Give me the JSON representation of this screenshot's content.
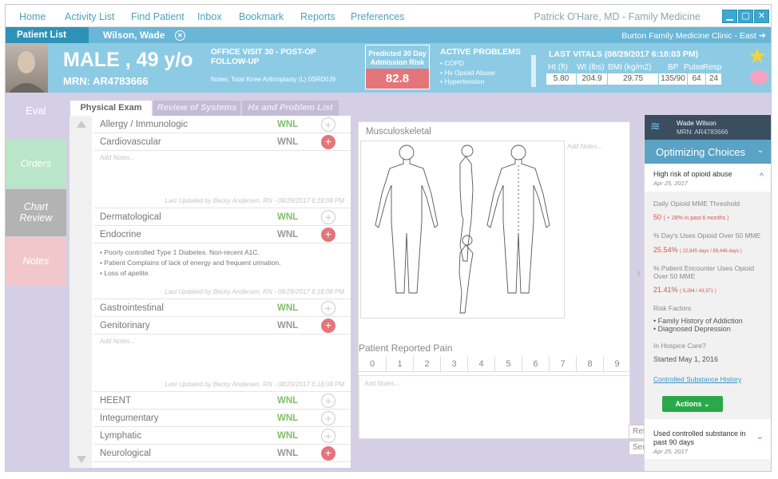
{
  "nav": {
    "items": [
      "Home",
      "Activity List",
      "Find Patient",
      "Inbox",
      "Bookmark",
      "Reports",
      "Preferences"
    ],
    "user": "Patrick O'Hare, MD - Family Medicine"
  },
  "patient_bar": {
    "list_tab": "Patient List",
    "name": "Wilson, Wade",
    "clinic": "Burton Family Medicine Clinic - East"
  },
  "patient": {
    "sex_age": "MALE , 49 y/o",
    "mrn": "MRN: AR4783666"
  },
  "visit": {
    "title_line1": "OFFICE VISIT 30 - POST-OP",
    "title_line2": "FOLLOW-UP",
    "notes": "Notes: Total Knee Arthroplasty (L) 0SRD0J9"
  },
  "risk": {
    "label_line1": "Predicted 30 Day",
    "label_line2": "Admission Risk",
    "value": "82.8"
  },
  "problems": {
    "title": "ACTIVE PROBLEMS",
    "items": [
      "• COPD",
      "• Hx Opioid Abuse",
      "• Hypertension"
    ]
  },
  "vitals": {
    "title": "LAST VITALS",
    "date": "(08/29/2017 6:18:03 PM)",
    "headers": [
      "Ht (ft)",
      "Wt (lbs)",
      "BMI (kg/m2)",
      "BP",
      "Pulse",
      "Resp"
    ],
    "values": [
      "5.80",
      "204.9",
      "29.75",
      "135/90",
      "64",
      "24"
    ]
  },
  "leftnav": {
    "eval": "Eval",
    "orders": "Orders",
    "chart1": "Chart",
    "chart2": "Review",
    "notes": "Notes"
  },
  "tabs": [
    "Physical Exam",
    "Review of Systems",
    "Hx and Problem List"
  ],
  "exam": {
    "wnl": "WNL",
    "add_notes": "Add Notes...",
    "last_updated": "Last Updated by Becky Andersen, RN - 08/29/2017 6:18:08 PM",
    "rows": [
      "Allergy / Immunologic",
      "Cardiovascular",
      "Dermatological",
      "Endocrine",
      "Gastrointestinal",
      "Genitorinary",
      "HEENT",
      "Integumentary",
      "Lymphatic",
      "Neurological"
    ],
    "endocrine_notes": [
      "• Poorly controlled Type 1 Diabetes. Non-recent A1C.",
      "• Patient Complains of lack of energy and frequent urination.",
      "• Loss of apetite."
    ]
  },
  "msk": {
    "title": "Musculoskeletal",
    "add_notes": "Add Notes..."
  },
  "pain": {
    "title": "Patient Reported Pain",
    "scale": [
      "0",
      "1",
      "2",
      "3",
      "4",
      "5",
      "6",
      "7",
      "8",
      "9"
    ],
    "add_notes": "Add Notes...",
    "btn1": "Ref",
    "btn2": "Ser"
  },
  "sidebar": {
    "patient_name": "Wade Wilson",
    "patient_mrn": "MRN: AR4783666",
    "title": "Optimizing Choices",
    "alert1_title": "High risk of opioid abuse",
    "alert1_date": "Apr 25, 2017",
    "mme_label": "Daily Opioid MME Threshold",
    "mme_value": "50",
    "mme_note": "( + 28% in past 6 months )",
    "days_label_1": "% Day's Uses Opioid Over 50 MME",
    "days_value": "25.54%",
    "days_note": "( 22,845 days / 89,446 days )",
    "enc_label_1": "% Patient Encounter Uses Opioid",
    "enc_label_2": "Over 50 MME",
    "enc_value": "21.41%",
    "enc_note": "( 9,284 / 43,371 )",
    "risk_label": "Risk Factors",
    "risk_items": [
      "• Family History of Addiction",
      "• Diagnosed Depression"
    ],
    "hospice_label": "In Hospice Care?",
    "hospice_value": "Started May 1, 2016",
    "link": "Controlled Substance History",
    "actions": "Actions",
    "alert2_title_1": "Used controlled substance in",
    "alert2_title_2": "past 90 days",
    "alert2_date": "Apr 25, 2017"
  },
  "colors": {
    "accent": "#4aa3bf",
    "header": "#8dcbe4",
    "risk": "#e2767b",
    "wnl": "#7fbf6a",
    "plus": "#e2767b",
    "orders": "#b9e5c8",
    "chart": "#b3b3b3",
    "notes": "#f2c7cc",
    "sidebar_dark": "#3a4e5f"
  }
}
